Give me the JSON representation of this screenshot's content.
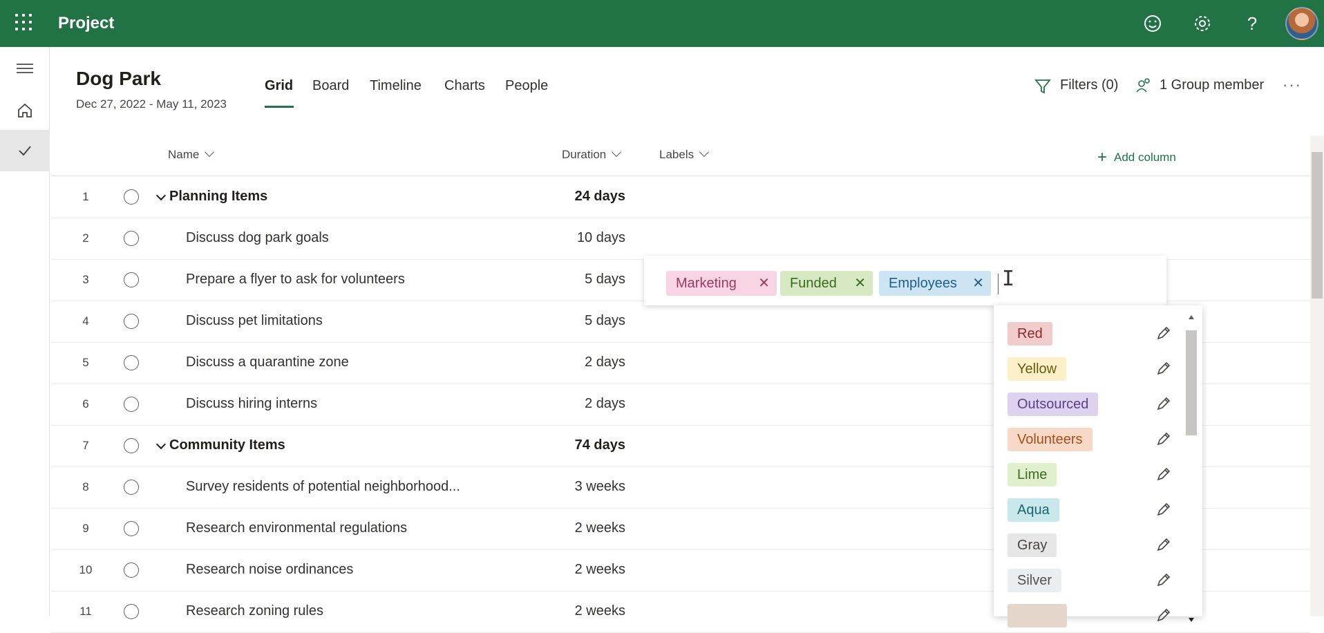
{
  "app": {
    "title": "Project"
  },
  "project": {
    "title": "Dog Park",
    "dates": "Dec 27, 2022 - May 11, 2023"
  },
  "tabs": [
    {
      "label": "Grid",
      "active": true
    },
    {
      "label": "Board"
    },
    {
      "label": "Timeline"
    },
    {
      "label": "Charts"
    },
    {
      "label": "People"
    }
  ],
  "header_actions": {
    "filters": "Filters (0)",
    "members": "1 Group member",
    "more": "···"
  },
  "columns": {
    "name": "Name",
    "duration": "Duration",
    "labels": "Labels",
    "add_column": "Add column"
  },
  "rows": [
    {
      "num": "1",
      "name": "Planning Items",
      "duration": "24 days",
      "group": true
    },
    {
      "num": "2",
      "name": "Discuss dog park goals",
      "duration": "10 days"
    },
    {
      "num": "3",
      "name": "Prepare a flyer to ask for volunteers",
      "duration": "5 days"
    },
    {
      "num": "4",
      "name": "Discuss pet limitations",
      "duration": "5 days"
    },
    {
      "num": "5",
      "name": "Discuss a quarantine zone",
      "duration": "2 days"
    },
    {
      "num": "6",
      "name": "Discuss hiring interns",
      "duration": "2 days"
    },
    {
      "num": "7",
      "name": "Community Items",
      "duration": "74 days",
      "group": true
    },
    {
      "num": "8",
      "name": "Survey residents of potential neighborhood...",
      "duration": "3 weeks"
    },
    {
      "num": "9",
      "name": "Research environmental regulations",
      "duration": "2 weeks"
    },
    {
      "num": "10",
      "name": "Research noise ordinances",
      "duration": "2 weeks"
    },
    {
      "num": "11",
      "name": "Research zoning rules",
      "duration": "2 weeks"
    }
  ],
  "label_editor": {
    "chips": [
      {
        "label": "Marketing",
        "bg": "#f8d5e4",
        "fg": "#9b3a63"
      },
      {
        "label": "Funded",
        "bg": "#d7e9c3",
        "fg": "#3d6b1e"
      },
      {
        "label": "Employees",
        "bg": "#cde4f3",
        "fg": "#1f5f8b"
      }
    ]
  },
  "label_options": [
    {
      "label": "Red",
      "bg": "#f1cccd",
      "fg": "#8c2a2e"
    },
    {
      "label": "Yellow",
      "bg": "#fbf0c7",
      "fg": "#6a5a10"
    },
    {
      "label": "Outsourced",
      "bg": "#ddd3ee",
      "fg": "#5a3e8a"
    },
    {
      "label": "Volunteers",
      "bg": "#f8d9c8",
      "fg": "#a34f1d"
    },
    {
      "label": "Lime",
      "bg": "#e1f0cc",
      "fg": "#3d6b1e"
    },
    {
      "label": "Aqua",
      "bg": "#c9e8ec",
      "fg": "#1a6470"
    },
    {
      "label": "Gray",
      "bg": "#e6e6e6",
      "fg": "#484644"
    },
    {
      "label": "Silver",
      "bg": "#ebeef0",
      "fg": "#4d5257"
    },
    {
      "label": "",
      "bg": "#e5d6cc",
      "fg": "#6b4b36"
    }
  ]
}
